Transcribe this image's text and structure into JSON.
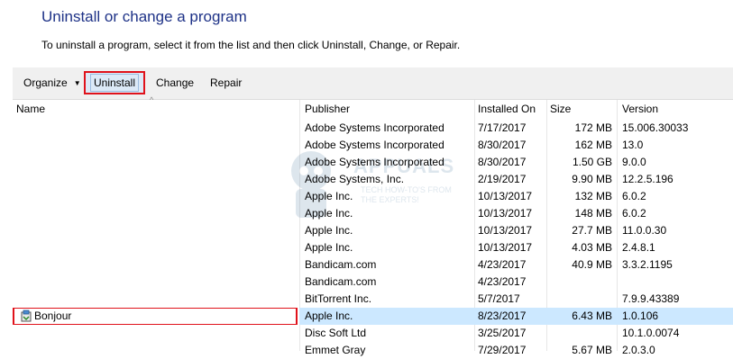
{
  "window": {
    "title": "Uninstall or change a program",
    "subtitle": "To uninstall a program, select it from the list and then click Uninstall, Change, or Repair."
  },
  "toolbar": {
    "organize_label": "Organize",
    "uninstall_label": "Uninstall",
    "change_label": "Change",
    "repair_label": "Repair"
  },
  "columns": {
    "name": "Name",
    "publisher": "Publisher",
    "installed_on": "Installed On",
    "size": "Size",
    "version": "Version"
  },
  "rows": [
    {
      "name": "",
      "publisher": "Adobe Systems Incorporated",
      "installed_on": "7/17/2017",
      "size": "172 MB",
      "version": "15.006.30033"
    },
    {
      "name": "",
      "publisher": "Adobe Systems Incorporated",
      "installed_on": "8/30/2017",
      "size": "162 MB",
      "version": "13.0"
    },
    {
      "name": "",
      "publisher": "Adobe Systems Incorporated",
      "installed_on": "8/30/2017",
      "size": "1.50 GB",
      "version": "9.0.0"
    },
    {
      "name": "",
      "publisher": "Adobe Systems, Inc.",
      "installed_on": "2/19/2017",
      "size": "9.90 MB",
      "version": "12.2.5.196"
    },
    {
      "name": "",
      "publisher": "Apple Inc.",
      "installed_on": "10/13/2017",
      "size": "132 MB",
      "version": "6.0.2"
    },
    {
      "name": "",
      "publisher": "Apple Inc.",
      "installed_on": "10/13/2017",
      "size": "148 MB",
      "version": "6.0.2"
    },
    {
      "name": "",
      "publisher": "Apple Inc.",
      "installed_on": "10/13/2017",
      "size": "27.7 MB",
      "version": "11.0.0.30"
    },
    {
      "name": "",
      "publisher": "Apple Inc.",
      "installed_on": "10/13/2017",
      "size": "4.03 MB",
      "version": "2.4.8.1"
    },
    {
      "name": "",
      "publisher": "Bandicam.com",
      "installed_on": "4/23/2017",
      "size": "40.9 MB",
      "version": "3.3.2.1195"
    },
    {
      "name": "",
      "publisher": "Bandicam.com",
      "installed_on": "4/23/2017",
      "size": "",
      "version": ""
    },
    {
      "name": "",
      "publisher": "BitTorrent Inc.",
      "installed_on": "5/7/2017",
      "size": "",
      "version": "7.9.9.43389"
    },
    {
      "name": "Bonjour",
      "publisher": "Apple Inc.",
      "installed_on": "8/23/2017",
      "size": "6.43 MB",
      "version": "1.0.106",
      "selected": true,
      "icon": "installer-package-icon"
    },
    {
      "name": "",
      "publisher": "Disc Soft Ltd",
      "installed_on": "3/25/2017",
      "size": "",
      "version": "10.1.0.0074"
    },
    {
      "name": "",
      "publisher": "Emmet Gray",
      "installed_on": "7/29/2017",
      "size": "5.67 MB",
      "version": "2.0.3.0"
    }
  ],
  "watermark": {
    "brand": "APPUALS",
    "tagline_line1": "TECH HOW-TO'S FROM",
    "tagline_line2": "THE EXPERTS!"
  },
  "colors": {
    "title": "#1e3287",
    "highlight_box": "#e0121b",
    "selected_row": "#cce8ff",
    "toolbar_bg": "#f0f0f0"
  }
}
